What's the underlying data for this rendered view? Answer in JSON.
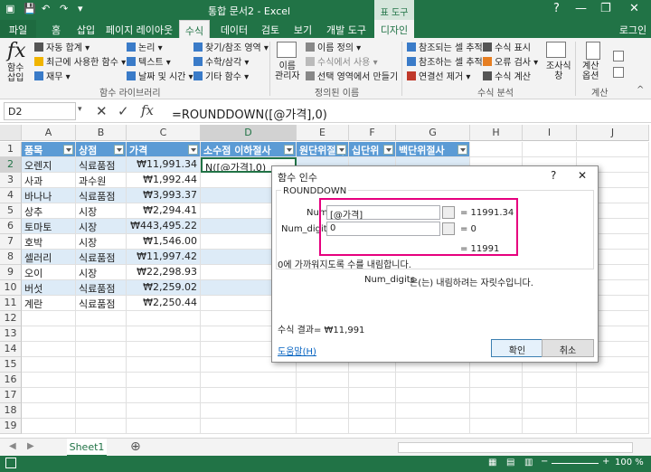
{
  "titlebar": {
    "title": "통합 문서2 - Excel",
    "table_tools": "표 도구",
    "win_help": "?",
    "win_min": "—",
    "win_max": "❐",
    "win_close": "✕"
  },
  "tabs": [
    "파일",
    "홈",
    "삽입",
    "페이지 레이아웃",
    "수식",
    "데이터",
    "검토",
    "보기",
    "개발 도구",
    "디자인",
    "로그인"
  ],
  "ribbon": {
    "insert_fn": "함수\n삽입",
    "fx": "fx",
    "autosum": "자동 합계",
    "recent": "최근에 사용한 함수",
    "finance": "재무",
    "logical": "논리",
    "text": "텍스트",
    "datetime": "날짜 및 시간",
    "lookup": "찾기/참조 영역",
    "math": "수학/삼각",
    "more": "기타 함수",
    "group_lib": "함수 라이브러리",
    "name_mgr": "이름\n관리자",
    "define_name": "이름 정의",
    "use_in_formula": "수식에서 사용",
    "create_sel": "선택 영역에서 만들기",
    "group_names": "정의된 이름",
    "trace_prec": "참조되는 셀 추적",
    "trace_dep": "참조하는 셀 추적",
    "remove_arrows": "연결선 제거",
    "show_formulas": "수식 표시",
    "error_check": "오류 검사",
    "eval_formula": "수식 계산",
    "group_audit": "수식 분석",
    "watch": "조사식\n창",
    "calc_opts": "계산\n옵션",
    "group_calc": "계산"
  },
  "formula_bar": {
    "namebox": "D2",
    "formula": "=ROUNDDOWN([@가격],0)"
  },
  "columns": [
    "A",
    "B",
    "C",
    "D",
    "E",
    "F",
    "G",
    "H",
    "I",
    "J"
  ],
  "table": {
    "headers": [
      "품목",
      "상점",
      "가격",
      "소수점 이하절사",
      "원단위절사",
      "십단위",
      "백단위절사"
    ],
    "rows": [
      [
        "오렌지",
        "식료품점",
        "₩11,991.34",
        "N([@가격],0)"
      ],
      [
        "사과",
        "과수원",
        "₩1,992.44",
        ""
      ],
      [
        "바나나",
        "식료품점",
        "₩3,993.37",
        ""
      ],
      [
        "상추",
        "시장",
        "₩2,294.41",
        ""
      ],
      [
        "토마토",
        "시장",
        "₩443,495.22",
        ""
      ],
      [
        "호박",
        "시장",
        "₩1,546.00",
        ""
      ],
      [
        "셀러리",
        "식료품점",
        "₩11,997.42",
        ""
      ],
      [
        "오이",
        "시장",
        "₩22,298.93",
        ""
      ],
      [
        "버섯",
        "식료품점",
        "₩2,259.02",
        ""
      ],
      [
        "계란",
        "식료품점",
        "₩2,250.44",
        ""
      ]
    ]
  },
  "row_numbers": [
    "1",
    "2",
    "3",
    "4",
    "5",
    "6",
    "7",
    "8",
    "9",
    "10",
    "11",
    "12",
    "13",
    "14",
    "15",
    "16",
    "17",
    "18",
    "19"
  ],
  "dialog": {
    "title": "함수 인수",
    "help_q": "?",
    "close": "✕",
    "fn_name": "ROUNDDOWN",
    "arg1_label": "Number",
    "arg1_value": "[@가격]",
    "arg1_result": "=  11991.34",
    "arg2_label": "Num_digits",
    "arg2_value": "0",
    "arg2_result": "=  0",
    "total_result": "=  11991",
    "description": "0에 가까워지도록 수를 내림합니다.",
    "arg_desc_label": "Num_digits",
    "arg_desc": "은(는) 내림하려는 자릿수입니다.",
    "formula_result": "수식 결과=  ₩11,991",
    "help_link": "도움말(H)",
    "ok": "확인",
    "cancel": "취소"
  },
  "sheet": {
    "tab": "Sheet1",
    "add": "⊕"
  },
  "status": {
    "zoom": "100 %",
    "minus": "−",
    "plus": "+"
  },
  "colors": {
    "excel_green": "#217346",
    "table_header": "#5b9bd5",
    "band": "#ddebf7",
    "highlight": "#e6007e"
  }
}
